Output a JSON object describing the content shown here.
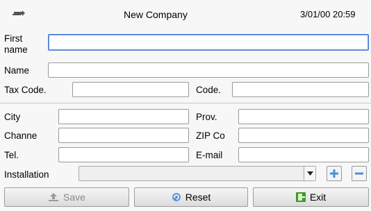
{
  "header": {
    "title": "New Company",
    "datetime": "3/01/00 20:59",
    "back_icon": "back-arrow-icon"
  },
  "form": {
    "first_name": {
      "label": "First name",
      "value": ""
    },
    "name": {
      "label": "Name",
      "value": ""
    },
    "tax_code": {
      "label": "Tax Code.",
      "value": ""
    },
    "code": {
      "label": "Code.",
      "value": ""
    },
    "city": {
      "label": "City",
      "value": ""
    },
    "prov": {
      "label": "Prov.",
      "value": ""
    },
    "channel": {
      "label": "Channe",
      "value": ""
    },
    "zip": {
      "label": "ZIP Co",
      "value": ""
    },
    "tel": {
      "label": "Tel.",
      "value": ""
    },
    "email": {
      "label": "E-mail",
      "value": ""
    },
    "installation": {
      "label": "Installation",
      "value": ""
    }
  },
  "buttons": {
    "save": "Save",
    "reset": "Reset",
    "exit": "Exit"
  },
  "colors": {
    "focus": "#4a7bd6",
    "plus_minus": "#4b8fd6",
    "exit_icon": "#3a9a2a"
  }
}
